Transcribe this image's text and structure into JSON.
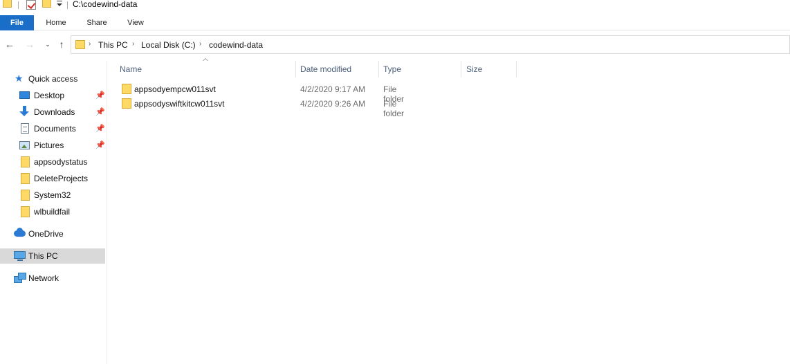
{
  "window": {
    "title": "C:\\codewind-data"
  },
  "quick_access_toolbar": {
    "icons": [
      "folder-icon",
      "properties-check-icon",
      "new-folder-icon",
      "customize-dropdown-icon"
    ]
  },
  "ribbon": {
    "tabs": [
      {
        "label": "File",
        "active": true
      },
      {
        "label": "Home"
      },
      {
        "label": "Share"
      },
      {
        "label": "View"
      }
    ],
    "accent_color": "#1a6ec7"
  },
  "navigation": {
    "back_icon": "arrow-left-icon",
    "forward_icon": "arrow-right-icon",
    "recent_icon": "chevron-down-icon",
    "up_icon": "arrow-up-icon"
  },
  "address_bar": {
    "crumbs": [
      "This PC",
      "Local Disk (C:)",
      "codewind-data"
    ]
  },
  "nav_pane": {
    "quick_access": "Quick access",
    "items": [
      {
        "label": "Desktop",
        "icon": "desktop-icon",
        "pinned": true
      },
      {
        "label": "Downloads",
        "icon": "downloads-icon",
        "pinned": true
      },
      {
        "label": "Documents",
        "icon": "documents-icon",
        "pinned": true
      },
      {
        "label": "Pictures",
        "icon": "pictures-icon",
        "pinned": true
      },
      {
        "label": "appsodystatus",
        "icon": "folder-icon",
        "pinned": false
      },
      {
        "label": "DeleteProjects",
        "icon": "folder-icon",
        "pinned": false
      },
      {
        "label": "System32",
        "icon": "folder-icon",
        "pinned": false
      },
      {
        "label": "wlbuildfail",
        "icon": "folder-icon",
        "pinned": false
      }
    ],
    "onedrive": "OneDrive",
    "this_pc": "This PC",
    "network": "Network",
    "selected": "This PC"
  },
  "file_list": {
    "columns": [
      "Name",
      "Date modified",
      "Type",
      "Size"
    ],
    "sorted_by": "Name",
    "rows": [
      {
        "name": "appsodyempcw011svt",
        "date": "4/2/2020 9:17 AM",
        "type": "File folder",
        "size": ""
      },
      {
        "name": "appsodyswiftkitcw011svt",
        "date": "4/2/2020 9:26 AM",
        "type": "File folder",
        "size": ""
      }
    ]
  }
}
